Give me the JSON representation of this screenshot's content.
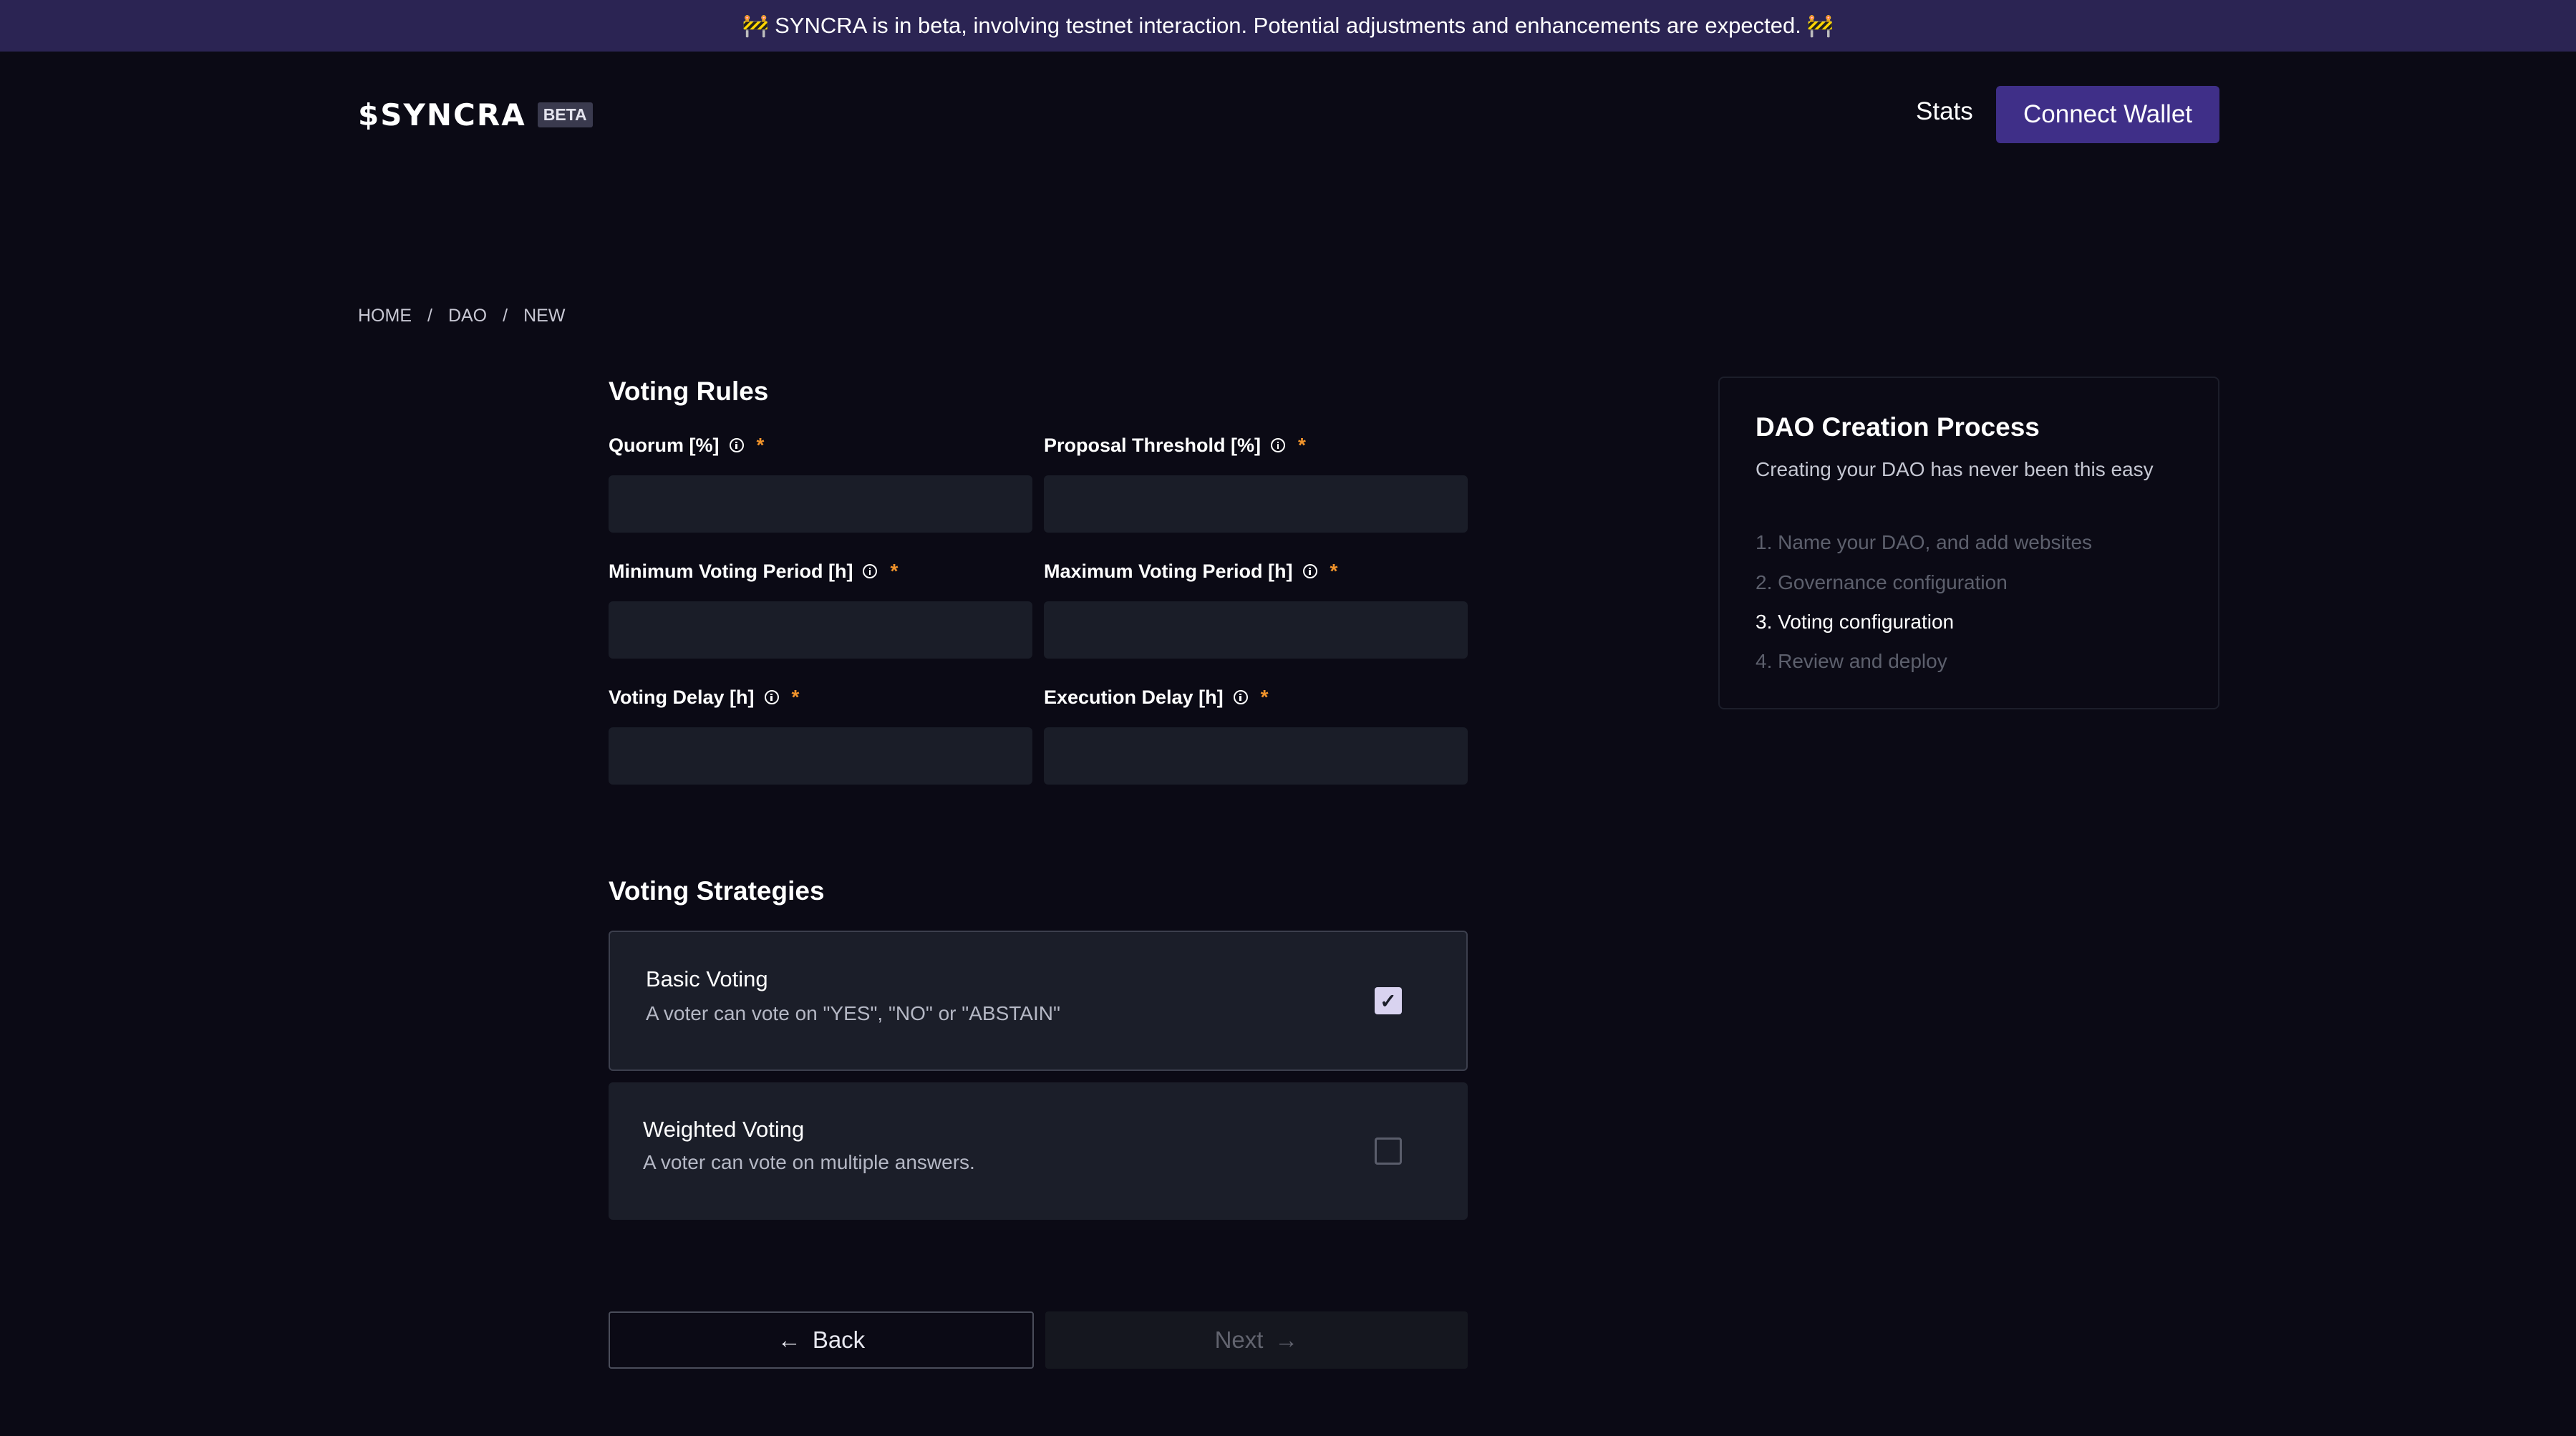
{
  "banner": {
    "icon_left": "🚧",
    "text": "SYNCRA is in beta, involving testnet interaction. Potential adjustments and enhancements are expected.",
    "icon_right": "🚧"
  },
  "header": {
    "logo_text": "$SYNCRA",
    "beta_badge": "BETA",
    "stats_link": "Stats",
    "connect_wallet": "Connect Wallet"
  },
  "breadcrumb": {
    "home": "HOME",
    "sep1": "/",
    "dao": "DAO",
    "sep2": "/",
    "new": "NEW"
  },
  "voting_rules": {
    "title": "Voting Rules",
    "required_mark": "*",
    "fields": [
      {
        "label": "Quorum [%]",
        "value": ""
      },
      {
        "label": "Proposal Threshold [%]",
        "value": ""
      },
      {
        "label": "Minimum Voting Period [h]",
        "value": ""
      },
      {
        "label": "Maximum Voting Period [h]",
        "value": ""
      },
      {
        "label": "Voting Delay [h]",
        "value": ""
      },
      {
        "label": "Execution Delay [h]",
        "value": ""
      }
    ]
  },
  "voting_strategies": {
    "title": "Voting Strategies",
    "items": [
      {
        "title": "Basic Voting",
        "description": "A voter can vote on \"YES\", \"NO\" or \"ABSTAIN\"",
        "checked": true,
        "check_glyph": "✓"
      },
      {
        "title": "Weighted Voting",
        "description": "A voter can vote on multiple answers.",
        "checked": false
      }
    ]
  },
  "actions": {
    "back_label": "Back",
    "back_arrow": "←",
    "next_label": "Next",
    "next_arrow": "→"
  },
  "process": {
    "title": "DAO Creation Process",
    "subtitle": "Creating your DAO has never been this easy",
    "steps": [
      {
        "label": "1. Name your DAO, and add websites"
      },
      {
        "label": "2. Governance configuration"
      },
      {
        "label": "3. Voting configuration"
      },
      {
        "label": "4. Review and deploy"
      }
    ],
    "active_step": 3
  },
  "colors": {
    "background": "#0b0a15",
    "banner": "#2b2453",
    "accent": "#3f2f88",
    "required": "#f0932b"
  }
}
